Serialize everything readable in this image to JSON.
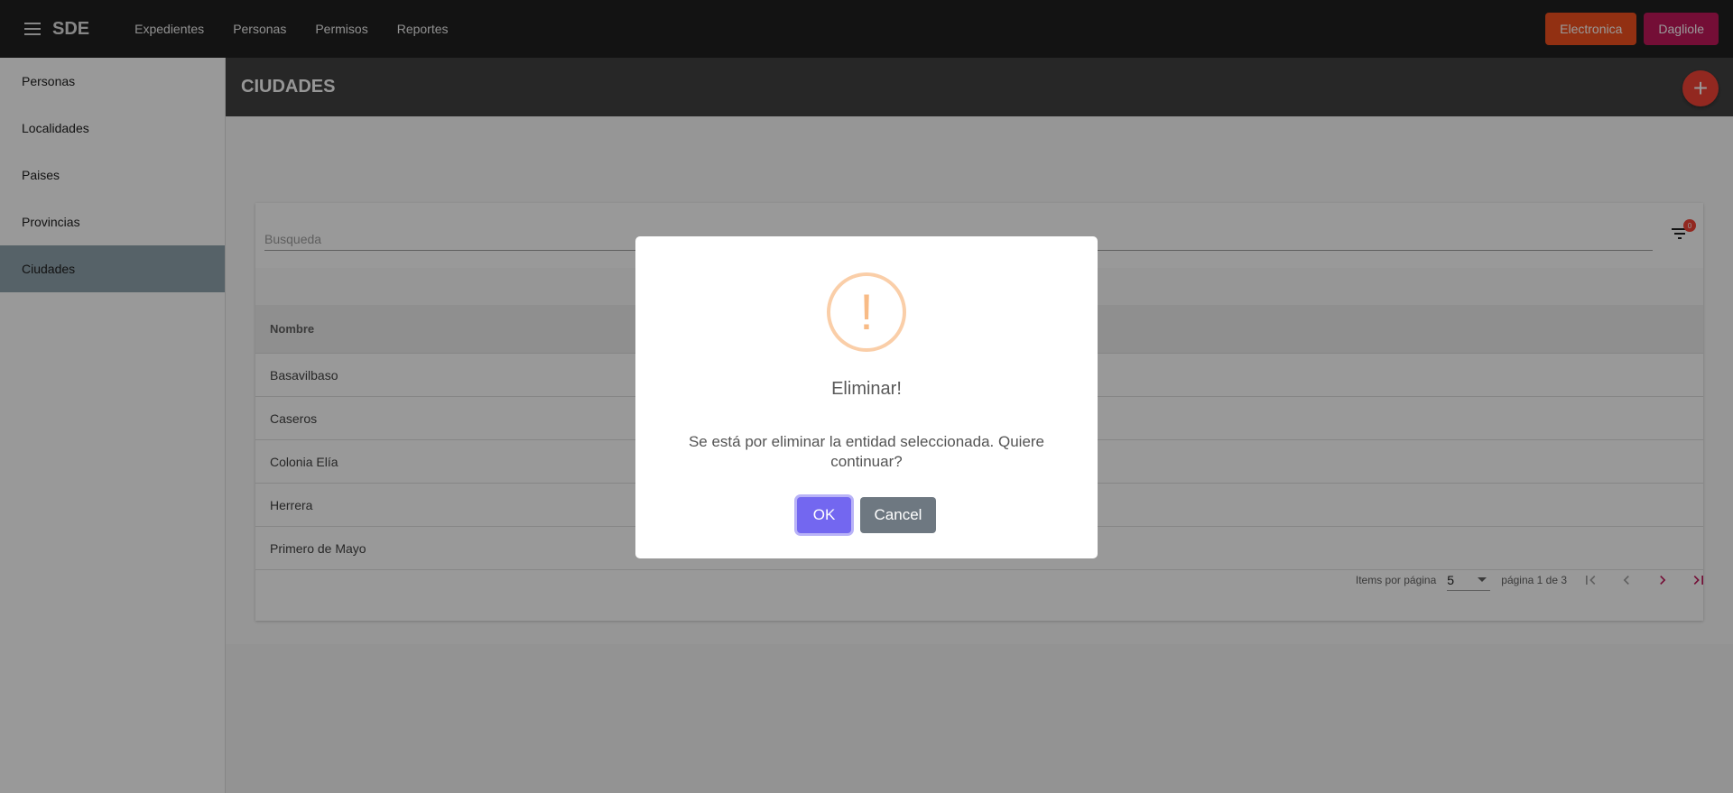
{
  "app": {
    "title": "SDE"
  },
  "nav": {
    "links": [
      "Expedientes",
      "Personas",
      "Permisos",
      "Reportes"
    ]
  },
  "topbar": {
    "electronica_label": "Electronica",
    "user_label": "Dagliole",
    "electronica_color": "#f4511e",
    "user_color": "#c2185b"
  },
  "sidebar": {
    "items": [
      "Personas",
      "Localidades",
      "Paises",
      "Provincias",
      "Ciudades"
    ],
    "active": "Ciudades"
  },
  "page": {
    "title": "CIUDADES",
    "fab_icon": "plus-icon"
  },
  "search": {
    "placeholder": "Busqueda",
    "filter_count": "0"
  },
  "table": {
    "header": "Nombre",
    "rows": [
      "Basavilbaso",
      "Caseros",
      "Colonia Elía",
      "Herrera",
      "Primero de Mayo"
    ]
  },
  "paginator": {
    "items_label": "Items por página",
    "page_size": "5",
    "range_label": "página 1 de 3"
  },
  "dialog": {
    "icon": "warning-icon",
    "title": "Eliminar!",
    "text": "Se está por eliminar la entidad seleccionada. Quiere continuar?",
    "ok_label": "OK",
    "cancel_label": "Cancel"
  }
}
